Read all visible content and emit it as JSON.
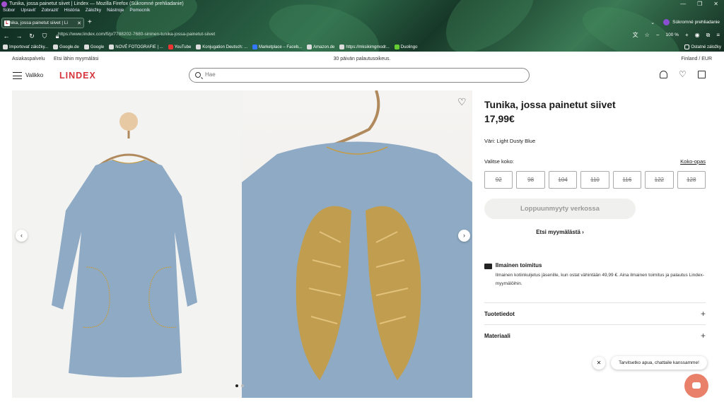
{
  "browser": {
    "window_title": "Tunika, jossa painetut siivet | Lindex — Mozilla Firefox (Súkromné prehliadanie)",
    "window_controls": [
      "—",
      "❐",
      "✕"
    ],
    "menu": [
      "Súbor",
      "Upraviť",
      "Zobraziť",
      "História",
      "Záložky",
      "Nástroje",
      "Pomocník"
    ],
    "tab_label": "Tunika, jossa painetut siivet | Li",
    "tab_favicon": "L",
    "private_label": "Súkromné prehliadanie",
    "url": "https://www.lindex.com/fi/p/7788202-7680-sininen-tunika-jossa-painetut-siivet",
    "zoom": "100 %",
    "bookmarks": [
      "Importovať záložky...",
      "Google.de",
      "Google",
      "NOVÉ FOTOGRAFIE | ...",
      "YouTube",
      "Konjugation Deutsch: ...",
      "Marketplace – Faceb...",
      "Amazon.de",
      "https://mksikimgmodr...",
      "Duolingo"
    ],
    "other_bookmarks": "Ostatné záložky"
  },
  "topbar": {
    "customer_service": "Asiakaspalvelu",
    "find_store": "Etsi lähin myymäläsi",
    "returns": "30 päivän palautusoikeus.",
    "region": "Finland / EUR"
  },
  "header": {
    "menu_label": "Valikko",
    "logo": "LINDEX",
    "search_placeholder": "Hae"
  },
  "product": {
    "title": "Tunika, jossa painetut siivet",
    "price": "17,99€",
    "color_label": "Väri:",
    "color_value": "Light Dusty Blue",
    "size_label": "Valitse koko:",
    "size_guide": "Koko-opas",
    "sizes": [
      "92",
      "98",
      "104",
      "110",
      "116",
      "122",
      "128"
    ],
    "soldout_button": "Loppuunmyyty verkossa",
    "find_in_store": "Etsi myymälästä",
    "delivery_title": "Ilmainen toimitus",
    "delivery_text": "Ilmainen kotiinkuljetus jäsenille, kun ostat vähintään 49,99 €. Aina ilmainen toimitus ja palautus Lindex-myymälöihin.",
    "accordions": [
      "Tuotetiedot",
      "Materiaali"
    ]
  },
  "chat": {
    "message": "Tarvitsetko apua, chattaile kanssamme!"
  },
  "colors": {
    "brand": "#d6343c",
    "garment": "#8eaac4",
    "gold": "#c99b3b",
    "chat_button": "#e8806a"
  }
}
